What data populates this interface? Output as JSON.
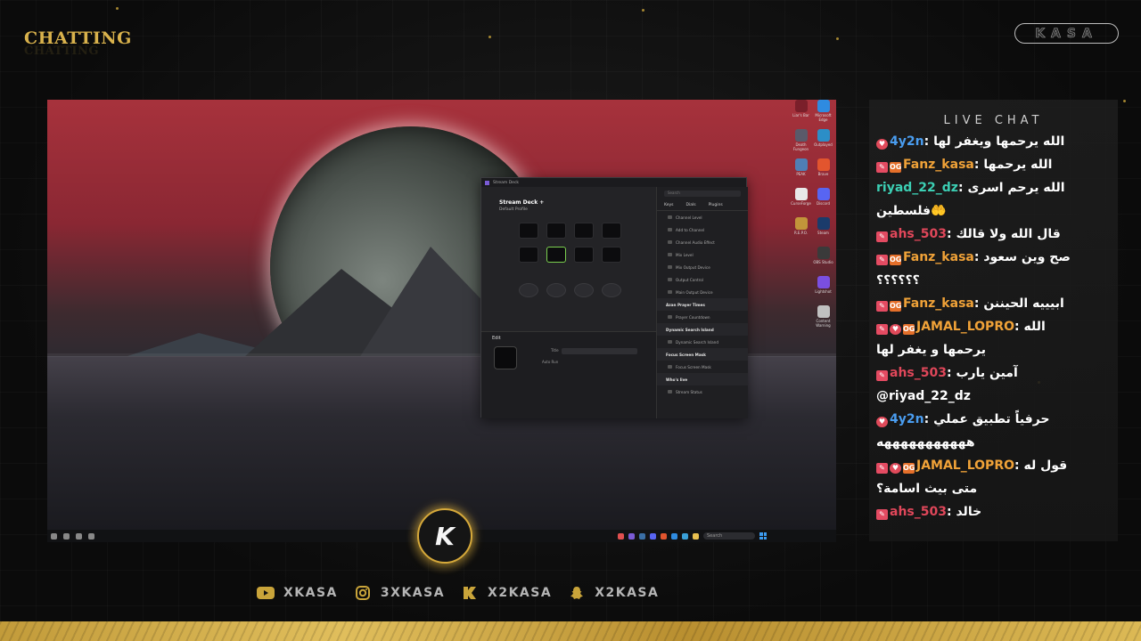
{
  "overlay": {
    "title": "CHATTING",
    "channel_badge": "KASA",
    "logo_letter": "K",
    "socials": [
      {
        "icon": "youtube-icon",
        "handle": "XKASA"
      },
      {
        "icon": "instagram-icon",
        "handle": "3XKASA"
      },
      {
        "icon": "kick-icon",
        "handle": "X2KASA"
      },
      {
        "icon": "snapchat-icon",
        "handle": "X2KASA"
      }
    ],
    "accent": "#d9b24c"
  },
  "chat": {
    "header": "LIVE CHAT",
    "messages": [
      {
        "user": "4y2n",
        "user_color": "#4a9df0",
        "badges": [
          "heart"
        ],
        "text": "الله يرحمها ويغفر لها",
        "cont": ""
      },
      {
        "user": "Fanz_kasa",
        "user_color": "#f0a238",
        "badges": [
          "mod",
          "og"
        ],
        "text": "الله يرحمها",
        "cont": ""
      },
      {
        "user": "riyad_22_dz",
        "user_color": "#3ccfb4",
        "badges": [],
        "text": "الله يرحم اسرى",
        "cont": "فلسطين🤲"
      },
      {
        "user": "ahs_503",
        "user_color": "#e0475a",
        "badges": [
          "mod"
        ],
        "text": "قال الله ولا قالك",
        "cont": ""
      },
      {
        "user": "Fanz_kasa",
        "user_color": "#f0a238",
        "badges": [
          "mod",
          "og"
        ],
        "text": "صح وين سعود",
        "cont": "؟؟؟؟؟؟"
      },
      {
        "user": "Fanz_kasa",
        "user_color": "#f0a238",
        "badges": [
          "mod",
          "og"
        ],
        "text": "ابيييه الحيننن",
        "cont": ""
      },
      {
        "user": "JAMAL_LOPRO",
        "user_color": "#f0a238",
        "badges": [
          "mod",
          "heart",
          "og"
        ],
        "text": "الله",
        "cont": "يرحمها و يغفر لها"
      },
      {
        "user": "ahs_503",
        "user_color": "#e0475a",
        "badges": [
          "mod"
        ],
        "text": "آمين يارب",
        "cont": "@riyad_22_dz"
      },
      {
        "user": "4y2n",
        "user_color": "#4a9df0",
        "badges": [
          "heart"
        ],
        "text": "حرفياً تطبيق عملي",
        "cont": "هههههههههههه"
      },
      {
        "user": "JAMAL_LOPRO",
        "user_color": "#f0a238",
        "badges": [
          "mod",
          "heart",
          "og"
        ],
        "text": "قول له",
        "cont": "متى بيث اسامة؟"
      },
      {
        "user": "ahs_503",
        "user_color": "#e0475a",
        "badges": [
          "mod"
        ],
        "text": "خالد",
        "cont": ""
      }
    ]
  },
  "desktop": {
    "stream_deck": {
      "window_title": "Stream Deck",
      "device": "Stream Deck +",
      "profile": "Default Profile",
      "search_placeholder": "Search",
      "tabs": [
        "Keys",
        "Dials",
        "Plugins"
      ],
      "actions": [
        {
          "label": "Channel Level",
          "header": false
        },
        {
          "label": "Add to Channel",
          "header": false
        },
        {
          "label": "Channel Audio Effect",
          "header": false
        },
        {
          "label": "Mix Level",
          "header": false
        },
        {
          "label": "Mix Output Device",
          "header": false
        },
        {
          "label": "Output Control",
          "header": false
        },
        {
          "label": "Main Output Device",
          "header": false
        },
        {
          "label": "Azan Prayer Times",
          "header": true
        },
        {
          "label": "Prayer Countdown",
          "header": false
        },
        {
          "label": "Dynamic Search Island",
          "header": true
        },
        {
          "label": "Dynamic Search Island",
          "header": false
        },
        {
          "label": "Focus Screen Mask",
          "header": true
        },
        {
          "label": "Focus Screen Mask",
          "header": false
        },
        {
          "label": "Who's live",
          "header": true
        },
        {
          "label": "Stream Status",
          "header": false
        }
      ],
      "edit_label": "Edit",
      "title_label": "Title",
      "auto_run_label": "Auto Run"
    },
    "desktop_icons": [
      "Liar's Bar",
      "Death Fungeon",
      "PEAK",
      "Brave",
      "CurseForge",
      "Discord",
      "R.E.P.O.",
      "Steam",
      "OBS Studio",
      "Lightshot",
      "Microsoft Edge",
      "Outplayed",
      "Content Warning"
    ],
    "taskbar_search": "Search"
  }
}
